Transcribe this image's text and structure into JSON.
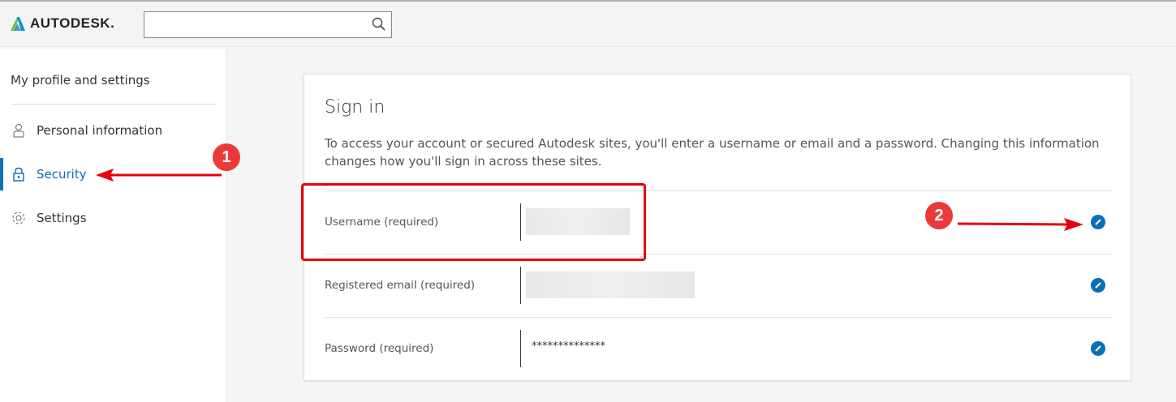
{
  "header": {
    "logo": "AUTODESK.",
    "search_placeholder": ""
  },
  "sidebar": {
    "title": "My profile and settings",
    "items": [
      {
        "label": "Personal information",
        "icon": "person-icon"
      },
      {
        "label": "Security",
        "icon": "lock-icon",
        "active": true
      },
      {
        "label": "Settings",
        "icon": "gear-icon"
      }
    ]
  },
  "card": {
    "title": "Sign in",
    "description": "To access your account or secured Autodesk sites, you'll enter a username or email and a password. Changing this information changes how you'll sign in across these sites.",
    "rows": [
      {
        "label": "Username (required)",
        "value": ""
      },
      {
        "label": "Registered email (required)",
        "value": ""
      },
      {
        "label": "Password (required)",
        "value": "**************"
      }
    ]
  },
  "annotations": {
    "badge1": "1",
    "badge2": "2",
    "color": "#ec3a3a"
  }
}
